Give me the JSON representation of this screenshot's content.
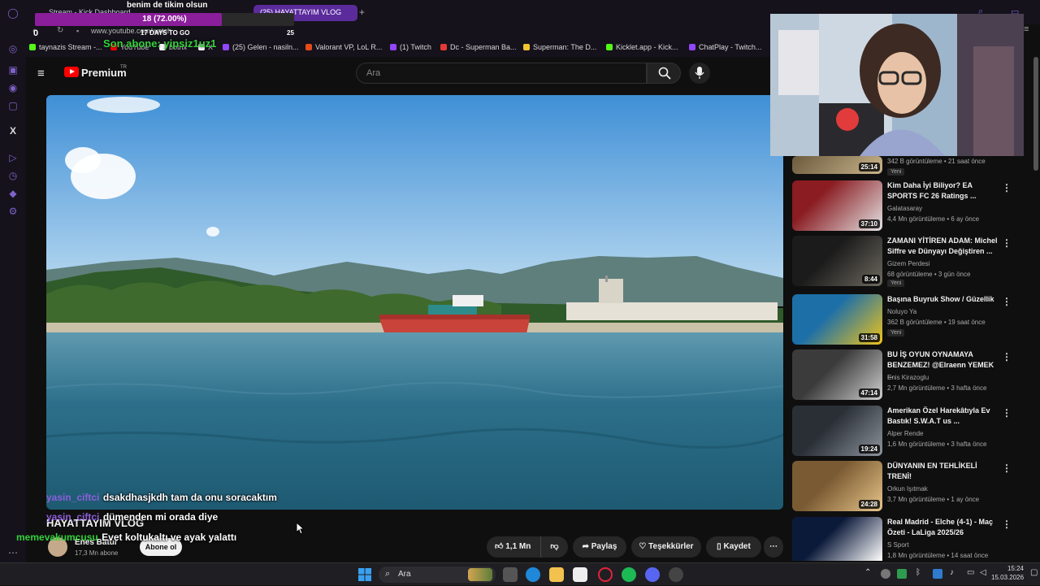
{
  "browser": {
    "tabs": [
      {
        "label": "Stream - Kick Dashboard",
        "active": false
      },
      {
        "label": "(25) HAYATTAYIM VLOG",
        "active": true
      }
    ],
    "url": "www.youtube.com/watch",
    "bookmarks": [
      {
        "label": "taynazis Stream -...",
        "color": "#53fc18"
      },
      {
        "label": "YouTube",
        "color": "#ff0000"
      },
      {
        "label": "botrix",
        "color": "#ffffff"
      },
      {
        "label": "X",
        "color": "#ffffff"
      },
      {
        "label": "(25) Gelen - nasiln...",
        "color": "#9146ff"
      },
      {
        "label": "Valorant VP, LoL R...",
        "color": "#e64b19"
      },
      {
        "label": "(1) Twitch",
        "color": "#9146ff"
      },
      {
        "label": "Dc - Superman Ba...",
        "color": "#e53935"
      },
      {
        "label": "Superman: The D...",
        "color": "#f4c430"
      },
      {
        "label": "Kicklet.app - Kick...",
        "color": "#53fc18"
      },
      {
        "label": "ChatPlay - Twitch...",
        "color": "#9146ff"
      }
    ]
  },
  "youtube": {
    "logo": "Premium",
    "logo_sup": "TR",
    "search_placeholder": "Ara",
    "video": {
      "title": "HAYATTAYIM VLOG",
      "channel": "Enes Batur",
      "subscribers": "17,3 Mn abone",
      "subscribe_label": "Abone ol",
      "likes": "1,1 Mn",
      "share_label": "Paylaş",
      "thanks_label": "Teşekkürler",
      "save_label": "Kaydet"
    },
    "recommendations": [
      {
        "title": "",
        "channel": "",
        "meta": "342 B görüntüleme • 21 saat önce",
        "duration": "25:14",
        "badge": "Yeni",
        "colors": [
          "#6b5a3e",
          "#c9b48a"
        ]
      },
      {
        "title": "Kim Daha İyi Biliyor? EA SPORTS FC 26 Ratings ...",
        "channel": "Galatasaray",
        "meta": "4,4 Mn görüntüleme • 6 ay önce",
        "duration": "37:10",
        "badge": "",
        "colors": [
          "#8a1c22",
          "#e3e3e3"
        ]
      },
      {
        "title": "ZAMANI YİTİREN ADAM: Michel Siffre ve Dünyayı Değiştiren ...",
        "channel": "Gizem Perdesi",
        "meta": "68 görüntüleme • 3 gün önce",
        "duration": "8:44",
        "badge": "Yeni",
        "colors": [
          "#1b1b1b",
          "#6e6a60"
        ]
      },
      {
        "title": "Başına Buyruk Show / Güzellik",
        "channel": "Noluyo Ya",
        "meta": "362 B görüntüleme • 19 saat önce",
        "duration": "31:58",
        "badge": "Yeni",
        "colors": [
          "#1d6fa8",
          "#f0c419"
        ]
      },
      {
        "title": "BU İŞ OYUN OYNAMAYA BENZEMEZ! @Elraenn YEMEK ...",
        "channel": "Enis Kirazoglu",
        "meta": "2,7 Mn görüntüleme • 3 hafta önce",
        "duration": "47:14",
        "badge": "",
        "colors": [
          "#3b3b3b",
          "#cfcfcf"
        ]
      },
      {
        "title": "Amerikan Özel Harekâtıyla Ev Bastık! S.W.A.T us ...",
        "channel": "Alper Rende",
        "meta": "1,6 Mn görüntüleme • 3 hafta önce",
        "duration": "19:24",
        "badge": "",
        "colors": [
          "#2a2f36",
          "#8d949c"
        ]
      },
      {
        "title": "DÜNYANIN EN TEHLİKELİ TRENİ!",
        "channel": "Orkun Işıtmak",
        "meta": "3,7 Mn görüntüleme • 1 ay önce",
        "duration": "24:28",
        "badge": "",
        "colors": [
          "#7a5a32",
          "#e8c58a"
        ]
      },
      {
        "title": "Real Madrid - Elche (4-1) - Maç Özeti - LaLiga 2025/26",
        "channel": "S Sport",
        "meta": "1,8 Mn görüntüleme • 14 saat önce",
        "duration": "",
        "badge": "",
        "colors": [
          "#0c1a3a",
          "#ffffff"
        ]
      }
    ]
  },
  "overlay": {
    "goal_title": "benim de tikim olsun",
    "goal_progress_text": "18 (72.00%)",
    "goal_progress": 0.72,
    "goal_left": "0",
    "goal_right": "25",
    "days_to_go": "17 DAYS TO GO",
    "last_sub": "Son abone: yipsiz1uz1",
    "chat": [
      {
        "user": "yasin_ciftci",
        "message": "dsakdhasjkdh tam da onu soracaktım"
      },
      {
        "user": "yasin_ciftci",
        "message": "dümenden mi orada diye"
      },
      {
        "user": "memevakumcusu",
        "message": "Evet koltukaltı ve ayak yalattı"
      }
    ]
  },
  "taskbar": {
    "search_placeholder": "Ara",
    "time": "15:24",
    "date": "15.03.2026"
  }
}
